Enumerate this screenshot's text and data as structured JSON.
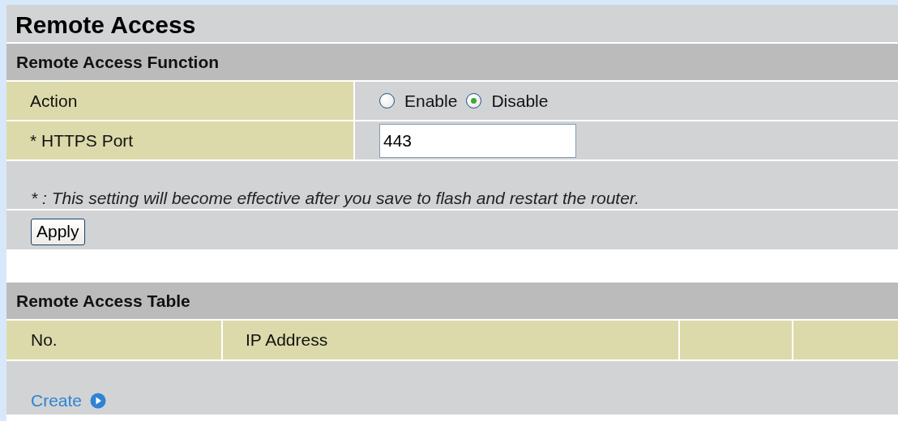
{
  "page_title": "Remote Access",
  "function_section": {
    "title": "Remote Access Function",
    "rows": [
      {
        "kind": "radio",
        "label": "Action",
        "options": [
          {
            "label": "Enable",
            "selected": false
          },
          {
            "label": "Disable",
            "selected": true
          }
        ]
      },
      {
        "kind": "text",
        "label": "* HTTPS Port",
        "value": "443"
      }
    ],
    "note": "* : This setting will become effective after you save to flash and restart the router.",
    "button": "Apply"
  },
  "table_section": {
    "title": "Remote Access Table",
    "columns": [
      "No.",
      "IP Address"
    ],
    "link": "Create"
  }
}
